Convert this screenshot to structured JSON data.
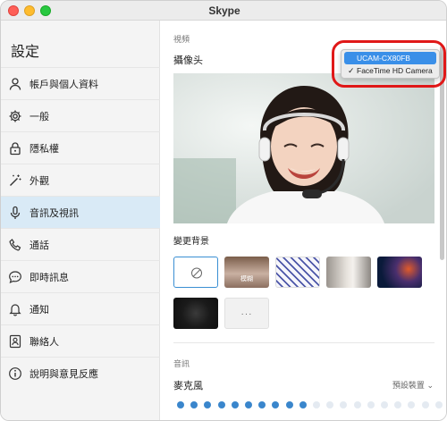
{
  "window": {
    "title": "Skype"
  },
  "sidebar": {
    "heading": "設定",
    "items": [
      {
        "label": "帳戶與個人資料",
        "icon": "person-icon"
      },
      {
        "label": "一般",
        "icon": "gear-icon"
      },
      {
        "label": "隱私權",
        "icon": "lock-icon"
      },
      {
        "label": "外觀",
        "icon": "magic-wand-icon"
      },
      {
        "label": "音訊及視訊",
        "icon": "microphone-icon",
        "active": true
      },
      {
        "label": "通話",
        "icon": "phone-icon"
      },
      {
        "label": "即時訊息",
        "icon": "chat-bubble-icon"
      },
      {
        "label": "通知",
        "icon": "bell-icon"
      },
      {
        "label": "聯絡人",
        "icon": "contact-card-icon"
      },
      {
        "label": "說明與意見反應",
        "icon": "info-icon"
      }
    ]
  },
  "main": {
    "video_section": "視頻",
    "camera_label": "攝像头",
    "background_label": "變更背景",
    "background_tiles": [
      {
        "name": "none",
        "icon": "prohibited-icon"
      },
      {
        "name": "blur",
        "text": "模糊"
      },
      {
        "name": "pattern"
      },
      {
        "name": "room"
      },
      {
        "name": "space"
      },
      {
        "name": "dark"
      },
      {
        "name": "more",
        "text": "···"
      }
    ],
    "audio_section": "音訊",
    "microphone_label": "麥克風",
    "microphone_device": "預設裝置",
    "mic_level": {
      "active_dots": 10,
      "total_dots": 20
    }
  },
  "camera_dropdown": {
    "options": [
      {
        "label": "UCAM-CX80FB",
        "highlighted": true,
        "checked": false
      },
      {
        "label": "FaceTime HD Camera",
        "highlighted": false,
        "checked": true
      }
    ],
    "check_glyph": "✓"
  },
  "colors": {
    "accent": "#3a8fe8",
    "sidebar_active": "#d9eaf6",
    "callout": "#e01818",
    "mic_dot_active": "#3a86cc",
    "mic_dot_inactive": "#e4eaf1"
  }
}
